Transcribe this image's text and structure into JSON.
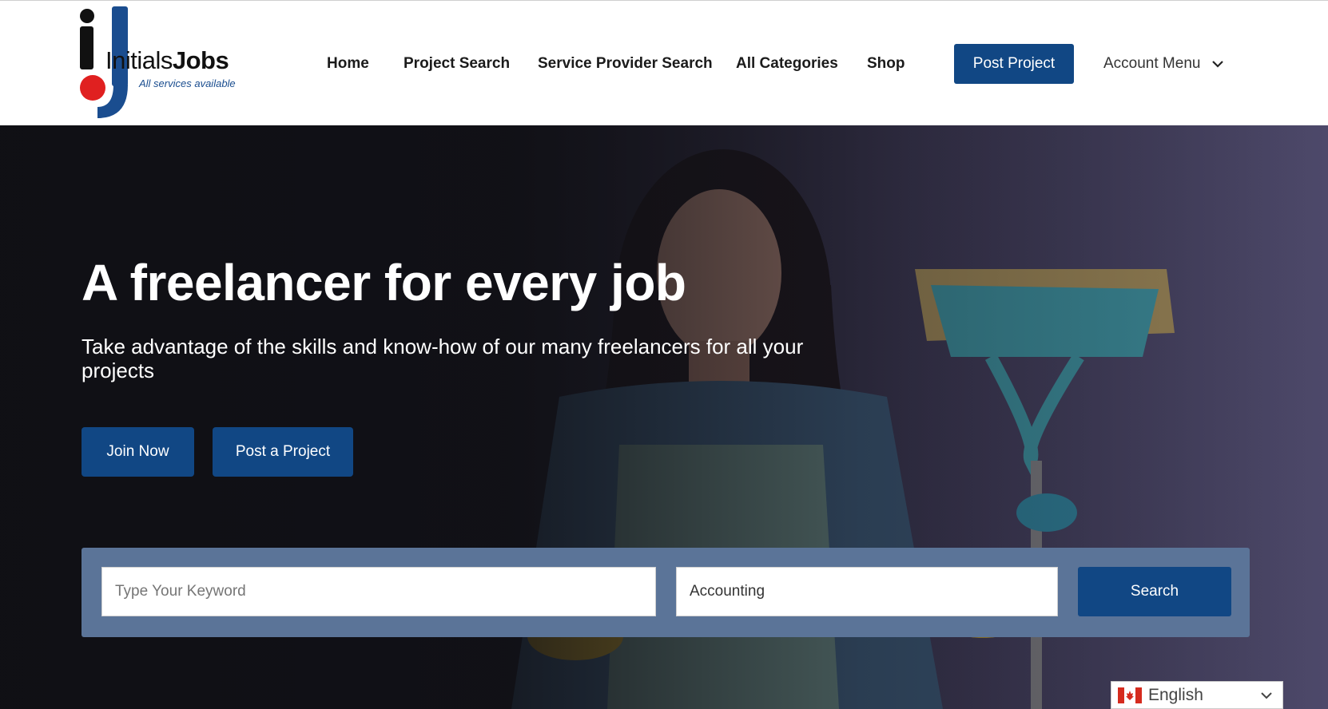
{
  "logo": {
    "name_thin": "Initials",
    "name_bold": "Jobs",
    "tagline": "All services available"
  },
  "nav": {
    "items": [
      "Home",
      "Project Search",
      "Service Provider Search",
      "All Categories",
      "Shop"
    ],
    "post_project": "Post Project",
    "account_menu": "Account Menu",
    "account_icon": "chevron-down-icon"
  },
  "hero": {
    "title": "A freelancer for every job",
    "subtitle": "Take advantage of the skills and know-how of our many freelancers for all your projects",
    "join_button": "Join Now",
    "post_button": "Post a Project"
  },
  "search": {
    "keyword_placeholder": "Type Your Keyword",
    "keyword_value": "",
    "category_value": "Accounting",
    "search_button": "Search"
  },
  "language": {
    "label": "English",
    "flag_icon": "canada-flag-icon"
  },
  "colors": {
    "brand": "#114784",
    "panel": "#5b7498",
    "logo_red": "#e02020",
    "logo_blue": "#1a4d8f"
  }
}
